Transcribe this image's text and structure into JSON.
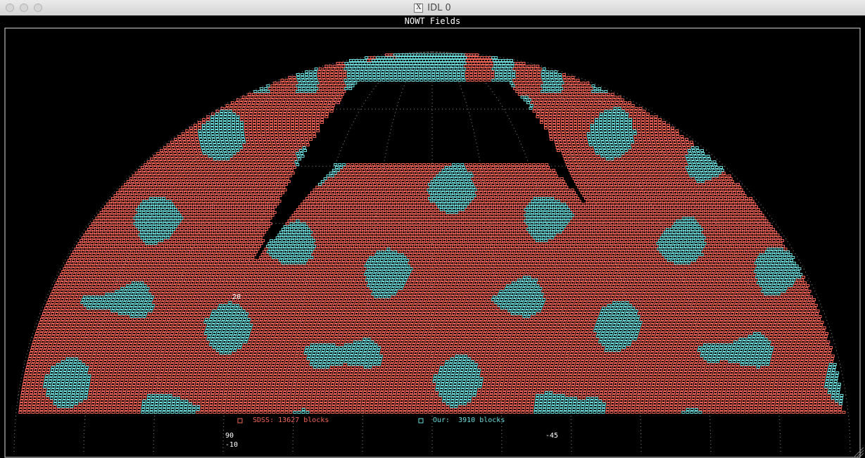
{
  "window": {
    "title": "IDL 0"
  },
  "chart_data": {
    "type": "scatter",
    "title": "NOWT Fields",
    "projection": "hammer-aitoff (partial sky)",
    "grid": true,
    "legend_placement": "bottom-center",
    "colors": {
      "sdss": "#f26355",
      "our": "#6cdcdc",
      "grid": "#8c8c8c",
      "background": "#000000",
      "text": "#ffffff"
    },
    "tick_labels": [
      {
        "id": "lat20",
        "text": "20"
      },
      {
        "id": "lon90",
        "text": "90"
      },
      {
        "id": "lonm45",
        "text": "-45"
      },
      {
        "id": "latm10",
        "text": "-10"
      }
    ],
    "series": [
      {
        "name": "SDSS: 13627 blocks",
        "count": 13627,
        "color": "#f26355",
        "marker": "open-square"
      },
      {
        "name": "Our:  3910 blocks",
        "count": 3910,
        "color": "#6cdcdc",
        "marker": "open-square"
      }
    ]
  }
}
